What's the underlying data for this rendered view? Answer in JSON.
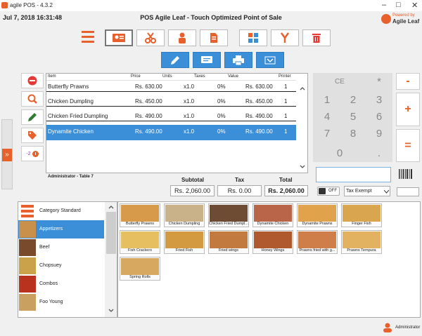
{
  "window": {
    "title": "agile POS - 4.3.2",
    "minimize": "–",
    "maximize": "□",
    "close": "✕"
  },
  "header": {
    "datetime": "Jul 7, 2018 16:31:48",
    "title": "POS Agile Leaf - Touch Optimized Point of Sale",
    "powered_by": "Powered by",
    "brand": "Agile Leaf"
  },
  "toolbar_top": [
    {
      "name": "customer-card-icon"
    },
    {
      "name": "scissors-icon"
    },
    {
      "name": "waiter-icon"
    },
    {
      "name": "document-icon"
    },
    {
      "name": "table-layout-icon"
    },
    {
      "name": "merge-icon"
    },
    {
      "name": "trash-icon"
    }
  ],
  "toolbar_second": [
    {
      "name": "edit-note-icon"
    },
    {
      "name": "comment-icon"
    },
    {
      "name": "print-icon"
    },
    {
      "name": "chevron-down-icon"
    }
  ],
  "left_actions": [
    "remove-icon",
    "search-icon",
    "edit-pen-icon",
    "price-tag-icon"
  ],
  "discount_badge": "-2",
  "order": {
    "columns": [
      "Item",
      "Price",
      "Units",
      "Taxes",
      "Value",
      "Printer"
    ],
    "rows": [
      {
        "item": "Butterfly Prawns",
        "price": "Rs. 630.00",
        "units": "x1.0",
        "taxes": "0%",
        "value": "Rs. 630.00",
        "printer": "1"
      },
      {
        "item": "Chicken Dumpling",
        "price": "Rs. 450.00",
        "units": "x1.0",
        "taxes": "0%",
        "value": "Rs. 450.00",
        "printer": "1"
      },
      {
        "item": "Chicken Fried Dumpling",
        "price": "Rs. 490.00",
        "units": "x1.0",
        "taxes": "0%",
        "value": "Rs. 490.00",
        "printer": "1"
      },
      {
        "item": "Dynamite Chicken",
        "price": "Rs. 490.00",
        "units": "x1.0",
        "taxes": "0%",
        "value": "Rs. 490.00",
        "printer": "1"
      }
    ],
    "selected_row": 3,
    "table_label": "Administrator - Table 7"
  },
  "totals": {
    "subtotal_label": "Subtotal",
    "subtotal": "Rs. 2,060.00",
    "tax_label": "Tax",
    "tax": "Rs. 0.00",
    "total_label": "Total",
    "total": "Rs. 2,060.00"
  },
  "keypad": {
    "ce": "CE",
    "mult": "*",
    "minus": "-",
    "plus": "+",
    "equals": "=",
    "digits": [
      "1",
      "2",
      "3",
      "4",
      "5",
      "6",
      "7",
      "8",
      "9"
    ],
    "zero": "0",
    "dot": "."
  },
  "toggle": {
    "state": "OFF"
  },
  "tax_select": {
    "value": "Tax Exempt"
  },
  "categories": [
    {
      "label": "Category Standard",
      "thumb": "#e8602c"
    },
    {
      "label": "Appetizers",
      "thumb": "#c8904a"
    },
    {
      "label": "Beef",
      "thumb": "#7a4a2c"
    },
    {
      "label": "Chopsuey",
      "thumb": "#c9a24a"
    },
    {
      "label": "Combos",
      "thumb": "#b8321e"
    },
    {
      "label": "Foo Young",
      "thumb": "#caa060"
    }
  ],
  "selected_category": 1,
  "products": [
    {
      "name": "Butterfly Prawns",
      "color": "#d79a4a"
    },
    {
      "name": "Chicken Dumpling",
      "color": "#c9b28a"
    },
    {
      "name": "Chicken Fried Dumpl...",
      "color": "#6e4c34"
    },
    {
      "name": "Dynamite Chicken",
      "color": "#b8654a"
    },
    {
      "name": "Dynamite Prawns",
      "color": "#e0a24a"
    },
    {
      "name": "Finger Fish",
      "color": "#d9a54e"
    },
    {
      "name": "Fish Crackers",
      "color": "#e6c060"
    },
    {
      "name": "Fried Fish",
      "color": "#d39a40"
    },
    {
      "name": "Fried wings",
      "color": "#c27a3e"
    },
    {
      "name": "Honey Wings",
      "color": "#b0582e"
    },
    {
      "name": "Prawns fried with g...",
      "color": "#cf7e4a"
    },
    {
      "name": "Prawns Tempura",
      "color": "#e2b260"
    },
    {
      "name": "Spring Rolls",
      "color": "#d6a860"
    }
  ],
  "status": {
    "user": "Administrator"
  },
  "colors": {
    "accent": "#e8602c",
    "selection": "#3b8fd9",
    "danger": "#e53935"
  }
}
